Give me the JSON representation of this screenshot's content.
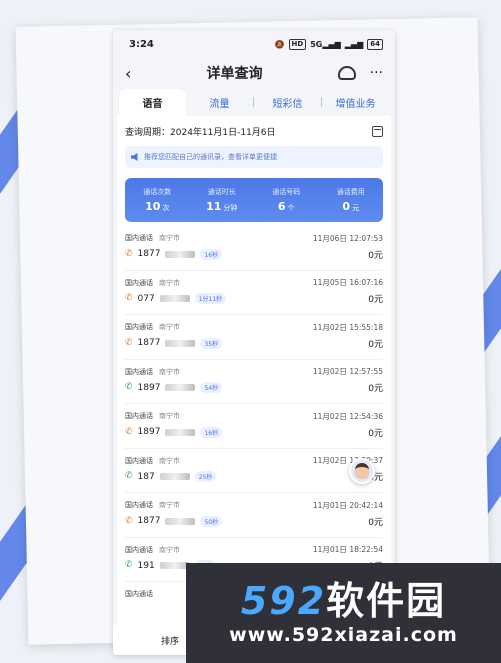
{
  "status_bar": {
    "time": "3:24",
    "icons": [
      "mute-icon",
      "hd-icon",
      "signal-5g-icon",
      "signal-icon",
      "battery-icon"
    ],
    "battery": "64"
  },
  "nav": {
    "title": "详单查询",
    "back_icon": "chevron-left-icon",
    "service_icon": "headset-icon",
    "more_icon": "more-icon"
  },
  "tabs": [
    {
      "label": "语音",
      "active": true
    },
    {
      "label": "流量",
      "active": false
    },
    {
      "label": "短彩信",
      "active": false
    },
    {
      "label": "增值业务",
      "active": false
    }
  ],
  "query": {
    "label": "查询周期：",
    "range": "2024年11月1日-11月6日"
  },
  "notice": {
    "text": "推荐您匹配自己的通讯录，查看详单更便捷"
  },
  "summary": [
    {
      "label": "通话次数",
      "value": "10",
      "unit": "次"
    },
    {
      "label": "通话时长",
      "value": "11",
      "unit": "分钟"
    },
    {
      "label": "通话号码",
      "value": "6",
      "unit": "个"
    },
    {
      "label": "通话费用",
      "value": "0",
      "unit": "元"
    }
  ],
  "calls": [
    {
      "type": "国内通话",
      "city": "南宁市",
      "datetime": "11月06日 12:07:53",
      "number": "1877",
      "direction": "out",
      "duration": "16秒",
      "fee": "0元"
    },
    {
      "type": "国内通话",
      "city": "南宁市",
      "datetime": "11月05日 16:07:16",
      "number": "077",
      "direction": "out",
      "duration": "1分11秒",
      "fee": "0元"
    },
    {
      "type": "国内通话",
      "city": "南宁市",
      "datetime": "11月02日 15:55:18",
      "number": "1877",
      "direction": "out",
      "duration": "35秒",
      "fee": "0元"
    },
    {
      "type": "国内通话",
      "city": "南宁市",
      "datetime": "11月02日 12:57:55",
      "number": "1897",
      "direction": "in",
      "duration": "54秒",
      "fee": "0元"
    },
    {
      "type": "国内通话",
      "city": "南宁市",
      "datetime": "11月02日 12:54:36",
      "number": "1897",
      "direction": "out",
      "duration": "16秒",
      "fee": "0元"
    },
    {
      "type": "国内通话",
      "city": "南宁市",
      "datetime": "11月02日 12:20:37",
      "number": "187",
      "direction": "in",
      "duration": "25秒",
      "fee": "0元"
    },
    {
      "type": "国内通话",
      "city": "南宁市",
      "datetime": "11月01日 20:42:14",
      "number": "1877",
      "direction": "out",
      "duration": "50秒",
      "fee": "0元"
    },
    {
      "type": "国内通话",
      "city": "南宁市",
      "datetime": "11月01日 18:22:54",
      "number": "191",
      "direction": "in",
      "duration": "10秒",
      "fee": "0元"
    },
    {
      "type": "国内通话",
      "city": "",
      "datetime": "",
      "number": "",
      "direction": "",
      "duration": "",
      "fee": ""
    }
  ],
  "bottom_bar": {
    "label": "排序"
  },
  "watermark": {
    "brand_num": "592",
    "brand_cn": "软件园",
    "url": "www.592xiazai.com"
  },
  "colors": {
    "accent": "#4a74e0",
    "outgoing": "#e2843e",
    "incoming": "#3ea85a",
    "watermark_blue": "#4aa8ff"
  }
}
